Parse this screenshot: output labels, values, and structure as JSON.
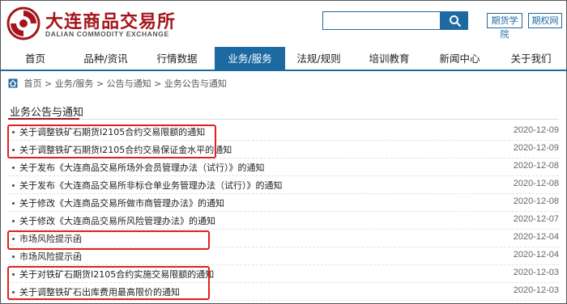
{
  "header": {
    "logo_cn": "大连商品交易所",
    "logo_en": "DALIAN COMMODITY EXCHANGE",
    "search_value": "",
    "links": [
      "期货学院",
      "期权网"
    ]
  },
  "nav": {
    "items": [
      "首页",
      "品种/资讯",
      "行情数据",
      "业务/服务",
      "法规/规则",
      "培训教育",
      "新闻中心",
      "关于我们"
    ],
    "active_index": 3
  },
  "breadcrumb": {
    "parts": [
      "首页",
      "业务/服务",
      "公告与通知",
      "业务公告与通知"
    ],
    "separator": ">"
  },
  "section": {
    "title": "业务公告与通知"
  },
  "notices": [
    {
      "title": "关于调整铁矿石期货I2105合约交易限额的通知",
      "date": "2020-12-09"
    },
    {
      "title": "关于调整铁矿石期货I2105合约交易保证金水平的通知",
      "date": "2020-12-09"
    },
    {
      "title": "关于发布《大连商品交易所场外会员管理办法（试行）》的通知",
      "date": "2020-12-08"
    },
    {
      "title": "关于发布《大连商品交易所非标仓单业务管理办法（试行）》的通知",
      "date": "2020-12-08"
    },
    {
      "title": "关于修改《大连商品交易所做市商管理办法》的通知",
      "date": "2020-12-08"
    },
    {
      "title": "关于修改《大连商品交易所风险管理办法》的通知",
      "date": "2020-12-07"
    },
    {
      "title": "市场风险提示函",
      "date": "2020-12-04"
    },
    {
      "title": "市场风险提示函",
      "date": "2020-12-04"
    },
    {
      "title": "关于对铁矿石期货I2105合约实施交易限额的通知",
      "date": "2020-12-03"
    },
    {
      "title": "关于调整铁矿石出库费用最高限价的通知",
      "date": "2020-12-03"
    }
  ],
  "colors": {
    "brand_red": "#a3161b",
    "nav_blue": "#1d6aa3",
    "highlight_red": "#e02020"
  }
}
